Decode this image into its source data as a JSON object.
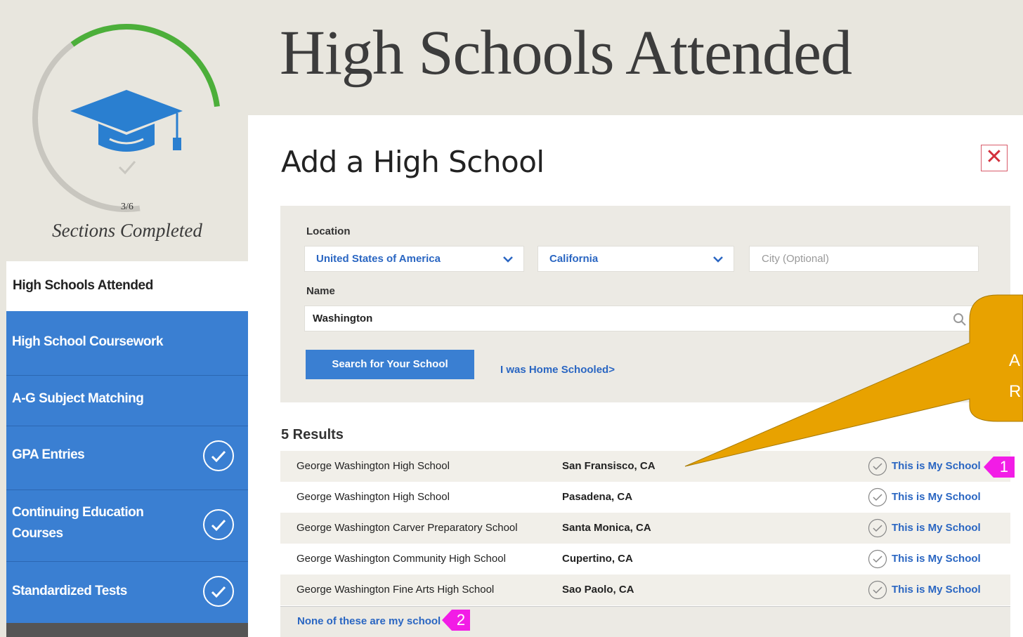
{
  "progress": {
    "completed": 3,
    "total": 6,
    "count_text": "3/6",
    "label": "Sections Completed",
    "colors": {
      "progress": "#4caf3a",
      "track": "#c8c6bf",
      "cap": "#2a7fd0"
    }
  },
  "sidebar": {
    "active_item": "High Schools Attended",
    "items": [
      {
        "label": "High School Coursework",
        "completed": false
      },
      {
        "label": "A-G Subject Matching",
        "completed": false
      },
      {
        "label": "GPA Entries",
        "completed": true
      },
      {
        "label": "Continuing Education Courses",
        "completed": true
      },
      {
        "label": "Standardized Tests",
        "completed": true
      }
    ]
  },
  "page": {
    "title": "High Schools Attended"
  },
  "modal": {
    "title": "Add a High School",
    "close_icon": "close-icon"
  },
  "search": {
    "location_label": "Location",
    "country": "United States of America",
    "state": "California",
    "city_placeholder": "City (Optional)",
    "name_label": "Name",
    "name_value": "Washington",
    "search_button": "Search for Your School",
    "home_schooled_link": "I was Home Schooled",
    "home_schooled_chevron": ">"
  },
  "results": {
    "count_label": "5 Results",
    "action_label": "This is My School",
    "rows": [
      {
        "name": "George Washington High School",
        "location": "San Fransisco, CA"
      },
      {
        "name": "George Washington High School",
        "location": "Pasadena, CA"
      },
      {
        "name": "George Washington Carver Preparatory School",
        "location": "Santa Monica, CA"
      },
      {
        "name": "George Washington Community High School",
        "location": "Cupertino, CA"
      },
      {
        "name": "George Washington Fine Arts High School",
        "location": "Sao Paolo, CA"
      }
    ],
    "none_link": "None of these are my school"
  },
  "annotations": {
    "marker_1": "1",
    "marker_2": "2",
    "marker_color": "#f21ce6",
    "callout_color": "#e8a200",
    "callout_line1": "A",
    "callout_line2": "R"
  }
}
